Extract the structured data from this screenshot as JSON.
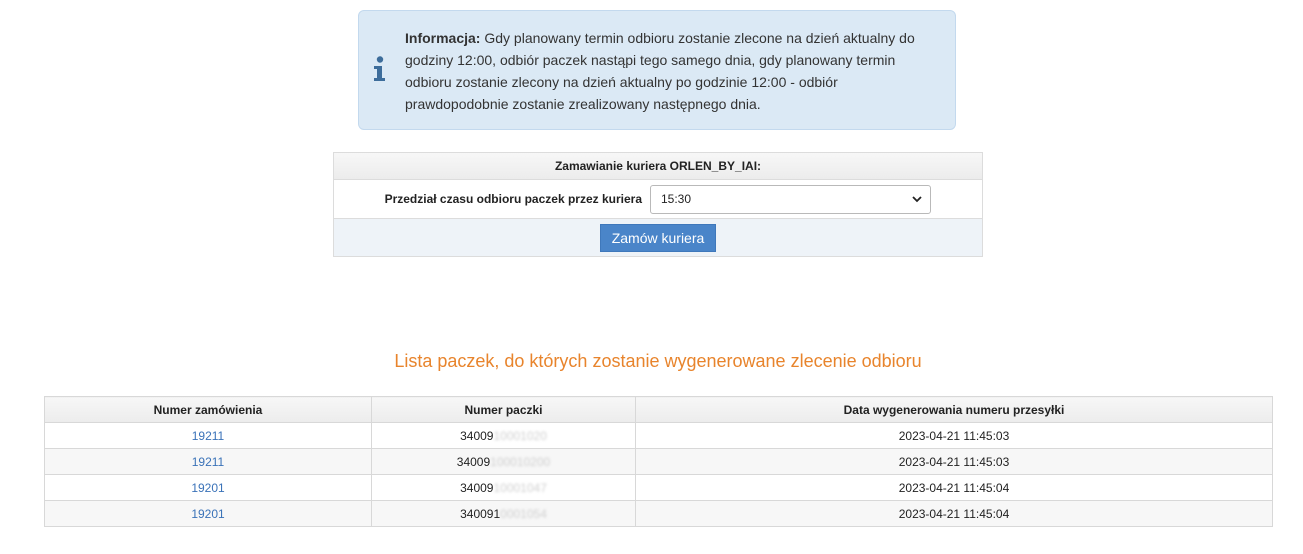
{
  "info": {
    "lead": "Informacja:",
    "text": " Gdy planowany termin odbioru zostanie zlecone na dzień aktualny do godziny 12:00, odbiór paczek nastąpi tego samego dnia, gdy planowany termin odbioru zostanie zlecony na dzień aktualny po godzinie 12:00 - odbiór prawdopodobnie zostanie zrealizowany następnego dnia.",
    "icon": "info-icon"
  },
  "courier_form": {
    "title": "Zamawianie kuriera ORLEN_BY_IAI:",
    "time_label": "Przedział czasu odbioru paczek przez kuriera",
    "time_value": "15:30",
    "submit_label": "Zamów kuriera",
    "accent_color": "#4a85c9"
  },
  "list": {
    "heading": "Lista paczek, do których zostanie wygenerowane zlecenie odbioru",
    "heading_color": "#e8842c",
    "columns": [
      "Numer zamówienia",
      "Numer paczki",
      "Data wygenerowania numeru przesyłki"
    ],
    "rows": [
      {
        "order": "19211",
        "parcel_prefix": "34009",
        "parcel_masked": "10001020",
        "date": "2023-04-21 11:45:03"
      },
      {
        "order": "19211",
        "parcel_prefix": "34009",
        "parcel_masked": "100010200",
        "date": "2023-04-21 11:45:03"
      },
      {
        "order": "19201",
        "parcel_prefix": "34009",
        "parcel_masked": "10001047",
        "date": "2023-04-21 11:45:04"
      },
      {
        "order": "19201",
        "parcel_prefix": "340091",
        "parcel_masked": "0001054",
        "date": "2023-04-21 11:45:04"
      }
    ]
  }
}
